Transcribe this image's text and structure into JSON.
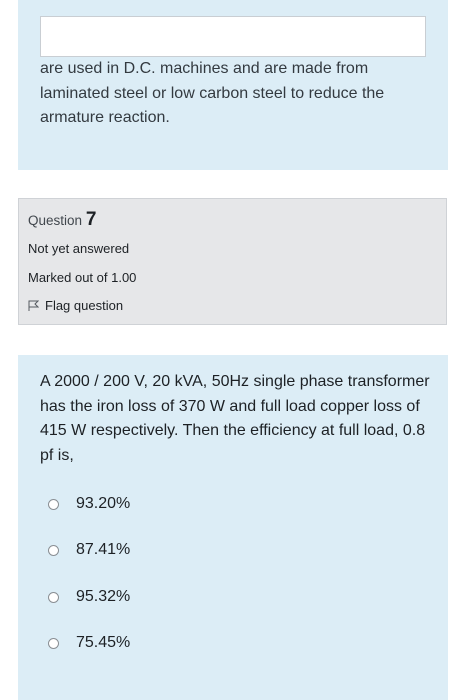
{
  "previous_question": {
    "text": "are used in D.C. machines and are made from laminated steel or low carbon steel to reduce the armature reaction."
  },
  "question_info": {
    "label": "Question",
    "number": "7",
    "status": "Not yet answered",
    "marks": "Marked out of 1.00",
    "flag_label": "Flag question"
  },
  "question": {
    "text": "A 2000 / 200 V, 20 kVA, 50Hz single phase transformer has the iron loss of 370 W and full load copper loss of  415 W respectively. Then the efficiency at full load, 0.8 pf is,",
    "options": [
      {
        "label": "93.20%"
      },
      {
        "label": "87.41%"
      },
      {
        "label": "95.32%"
      },
      {
        "label": "75.45%"
      }
    ]
  }
}
